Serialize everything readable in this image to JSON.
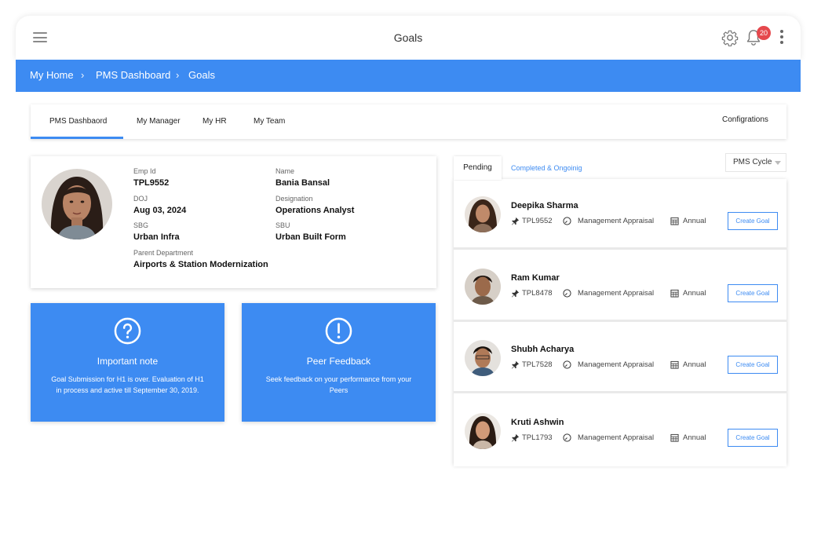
{
  "header": {
    "title": "Goals",
    "notification_count": "20"
  },
  "breadcrumb": [
    "My Home",
    "PMS Dashboard",
    "Goals"
  ],
  "tabs": {
    "pms_dashboard": "PMS Dashbaord",
    "my_manager": "My Manager",
    "my_hr": "My HR",
    "my_team": "My Team",
    "configurations": "Configrations"
  },
  "profile": {
    "emp_id_label": "Emp Id",
    "emp_id": "TPL9552",
    "name_label": "Name",
    "name": "Bania Bansal",
    "doj_label": "DOJ",
    "doj": "Aug 03, 2024",
    "designation_label": "Designation",
    "designation": "Operations Analyst",
    "sbg_label": "SBG",
    "sbg": "Urban Infra",
    "sbu_label": "SBU",
    "sbu": "Urban Built Form",
    "parent_department_label": "Parent Department",
    "parent_department": "Airports & Station Modernization"
  },
  "cards": {
    "important": {
      "icon": "question-circle-icon",
      "title": "Important note",
      "text": "Goal Submission for H1 is over. Evaluation of H1 in process and active till September 30, 2019."
    },
    "peer": {
      "icon": "exclamation-circle-icon",
      "title": "Peer Feedback",
      "text": "Seek feedback on your performance from your Peers"
    }
  },
  "panel": {
    "tab_pending": "Pending",
    "tab_completed": "Completed & Ongoinig",
    "cycle_select": "PMS Cycle",
    "create_goal_label": "Create Goal",
    "employees": [
      {
        "name": "Deepika Sharma",
        "id": "TPL9552",
        "type": "Management Appraisal",
        "period": "Annual"
      },
      {
        "name": "Ram Kumar",
        "id": "TPL8478",
        "type": "Management Appraisal",
        "period": "Annual"
      },
      {
        "name": "Shubh Acharya",
        "id": "TPL7528",
        "type": "Management Appraisal",
        "period": "Annual"
      },
      {
        "name": "Kruti Ashwin",
        "id": "TPL1793",
        "type": "Management Appraisal",
        "period": "Annual"
      }
    ]
  },
  "colors": {
    "accent": "#3d8bf2",
    "badge": "#e5484d"
  }
}
